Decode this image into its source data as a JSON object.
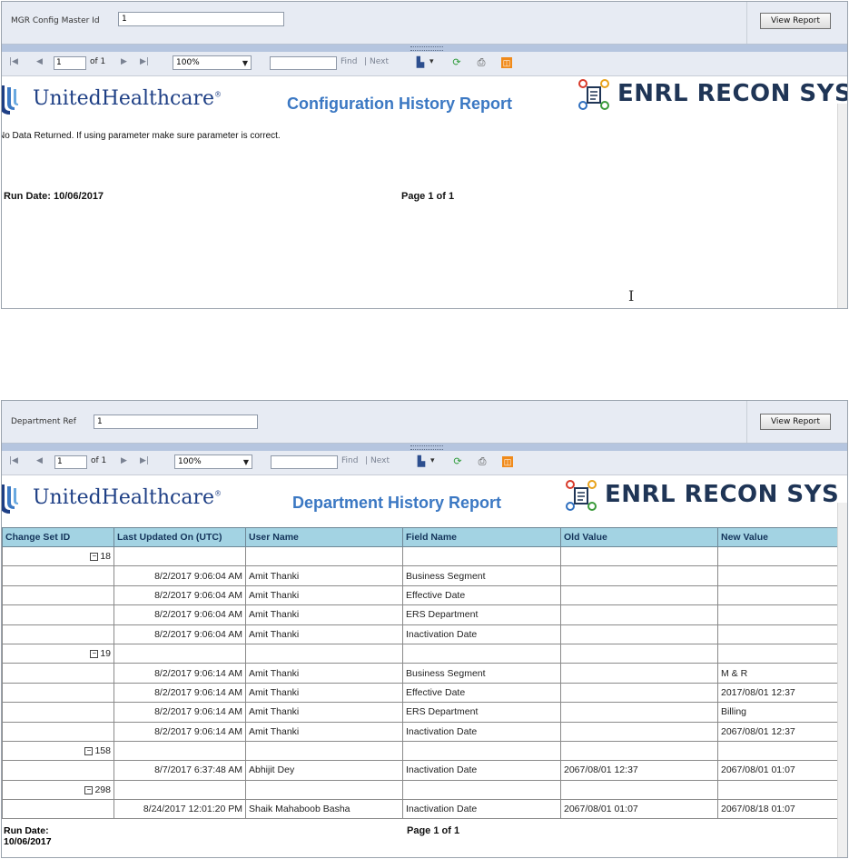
{
  "report1": {
    "param_label": "MGR Config Master Id",
    "param_value": "1",
    "view_report": "View Report",
    "toolbar": {
      "page_value": "1",
      "of_pages": "of 1",
      "zoom": "100%",
      "find": "Find",
      "sep": "|",
      "next": "Next"
    },
    "brand": "UnitedHealthcare",
    "title": "Configuration History Report",
    "app_logo": "ENRL RECON SYS",
    "message": "No Data Returned. If using parameter make sure parameter is correct.",
    "run_date": "Run Date: 10/06/2017",
    "page_info": "Page 1 of 1"
  },
  "report2": {
    "param_label": "Department Ref",
    "param_value": "1",
    "view_report": "View Report",
    "toolbar": {
      "page_value": "1",
      "of_pages": "of 1",
      "zoom": "100%",
      "find": "Find",
      "sep": "|",
      "next": "Next"
    },
    "brand": "UnitedHealthcare",
    "title": "Department History Report",
    "app_logo": "ENRL RECON SYS",
    "columns": [
      "Change Set ID",
      "Last Updated On (UTC)",
      "User Name",
      "Field Name",
      "Old Value",
      "New Value"
    ],
    "rows": [
      [
        "18",
        "",
        "",
        "",
        "",
        ""
      ],
      [
        "",
        "8/2/2017 9:06:04 AM",
        "Amit Thanki",
        "Business Segment",
        "",
        ""
      ],
      [
        "",
        "8/2/2017 9:06:04 AM",
        "Amit Thanki",
        "Effective Date",
        "",
        ""
      ],
      [
        "",
        "8/2/2017 9:06:04 AM",
        "Amit Thanki",
        "ERS Department",
        "",
        ""
      ],
      [
        "",
        "8/2/2017 9:06:04 AM",
        "Amit Thanki",
        "Inactivation Date",
        "",
        ""
      ],
      [
        "19",
        "",
        "",
        "",
        "",
        ""
      ],
      [
        "",
        "8/2/2017 9:06:14 AM",
        "Amit Thanki",
        "Business Segment",
        "",
        "M & R"
      ],
      [
        "",
        "8/2/2017 9:06:14 AM",
        "Amit Thanki",
        "Effective Date",
        "",
        "2017/08/01 12:37"
      ],
      [
        "",
        "8/2/2017 9:06:14 AM",
        "Amit Thanki",
        "ERS Department",
        "",
        "Billing"
      ],
      [
        "",
        "8/2/2017 9:06:14 AM",
        "Amit Thanki",
        "Inactivation Date",
        "",
        "2067/08/01 12:37"
      ],
      [
        "158",
        "",
        "",
        "",
        "",
        ""
      ],
      [
        "",
        "8/7/2017 6:37:48 AM",
        "Abhijit Dey",
        "Inactivation Date",
        "2067/08/01 12:37",
        "2067/08/01 01:07"
      ],
      [
        "298",
        "",
        "",
        "",
        "",
        ""
      ],
      [
        "",
        "8/24/2017 12:01:20 PM",
        "Shaik Mahaboob Basha",
        "Inactivation Date",
        "2067/08/01 01:07",
        "2067/08/18 01:07"
      ]
    ],
    "run_date_label": "Run Date:",
    "run_date_value": "10/06/2017",
    "page_info": "Page 1 of 1"
  },
  "colors": {
    "header_bg": "#a3d3e3",
    "title_blue": "#3b78c3",
    "brand_navy": "#1e3f85",
    "toolbar_bg": "#e7ebf3"
  },
  "icons": [
    "first-page-icon",
    "prev-page-icon",
    "next-page-icon",
    "last-page-icon",
    "export-icon",
    "refresh-icon",
    "print-icon",
    "data-feed-icon",
    "collapse-toggle-icon",
    "text-cursor-icon"
  ]
}
